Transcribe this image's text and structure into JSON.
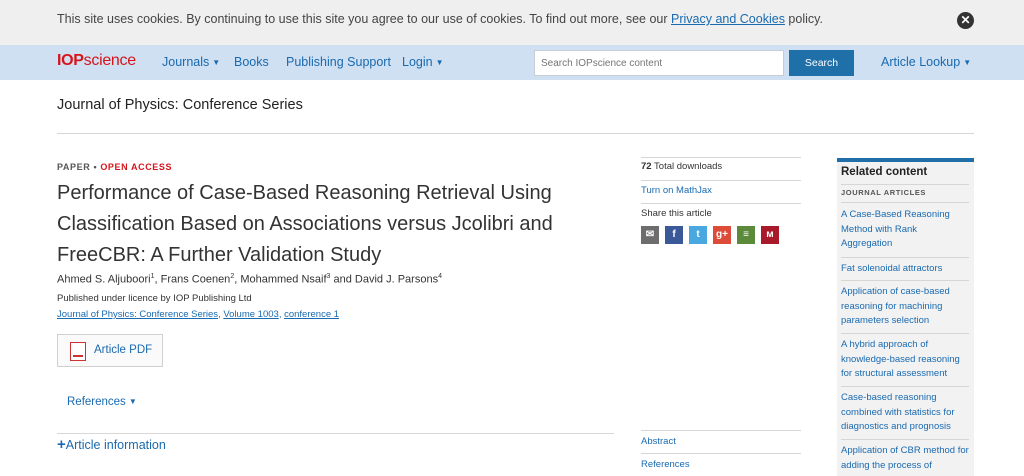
{
  "cookie": {
    "text_before": "This site uses cookies. By continuing to use this site you agree to our use of cookies. To find out more, see our ",
    "link": "Privacy and Cookies",
    "text_after": " policy.",
    "close_icon": "close-icon"
  },
  "nav": {
    "logo_iop": "IOP",
    "logo_science": "science",
    "journals": "Journals",
    "books": "Books",
    "publishing_support": "Publishing Support",
    "login": "Login",
    "search_placeholder": "Search IOPscience content",
    "search_button": "Search",
    "article_lookup": "Article Lookup"
  },
  "journal_title": "Journal of Physics: Conference Series",
  "article": {
    "type": "PAPER",
    "bullet": "•",
    "access": "OPEN ACCESS",
    "title": "Performance of Case-Based Reasoning Retrieval Using Classification Based on Associations versus Jcolibri and FreeCBR: A Further Validation Study",
    "authors": [
      {
        "name": "Ahmed S. Aljuboori",
        "sup": "1",
        "sep": ", "
      },
      {
        "name": "Frans Coenen",
        "sup": "2",
        "sep": ", "
      },
      {
        "name": "Mohammed Nsaif",
        "sup": "3",
        "sep": " and "
      },
      {
        "name": "David J. Parsons",
        "sup": "4",
        "sep": ""
      }
    ],
    "licence": "Published under licence by IOP Publishing Ltd",
    "cite_journal": "Journal of Physics: Conference Series",
    "cite_sep1": ", ",
    "cite_volume": "Volume 1003",
    "cite_sep2": ", ",
    "cite_conference": "conference 1",
    "pdf_button": "Article PDF",
    "references": "References",
    "article_info": "Article information"
  },
  "sidebar": {
    "downloads_count": "72",
    "downloads_label": " Total downloads",
    "mathjax": "Turn on MathJax",
    "share_label": "Share this article",
    "share_icons": [
      {
        "name": "email-icon",
        "glyph": "✉",
        "color": "#6d6d6d"
      },
      {
        "name": "facebook-icon",
        "glyph": "f",
        "color": "#3b5998"
      },
      {
        "name": "twitter-icon",
        "glyph": "t",
        "color": "#4aa8e0"
      },
      {
        "name": "google-plus-icon",
        "glyph": "g+",
        "color": "#dd4b39"
      },
      {
        "name": "bookmark-icon",
        "glyph": "≡",
        "color": "#5a8a3a"
      },
      {
        "name": "mendeley-icon",
        "glyph": "ᴍ",
        "color": "#a8192c"
      }
    ],
    "abstract": "Abstract",
    "references": "References"
  },
  "related": {
    "title": "Related content",
    "subtitle": "JOURNAL ARTICLES",
    "items": [
      "A Case-Based Reasoning Method with Rank Aggregation",
      "Fat solenoidal attractors",
      "Application of case-based reasoning for machining parameters selection",
      "A hybrid approach of knowledge-based reasoning for structural assessment",
      "Case-based reasoning combined with statistics for diagnostics and prognosis",
      "Application of CBR method for adding the process of"
    ]
  }
}
